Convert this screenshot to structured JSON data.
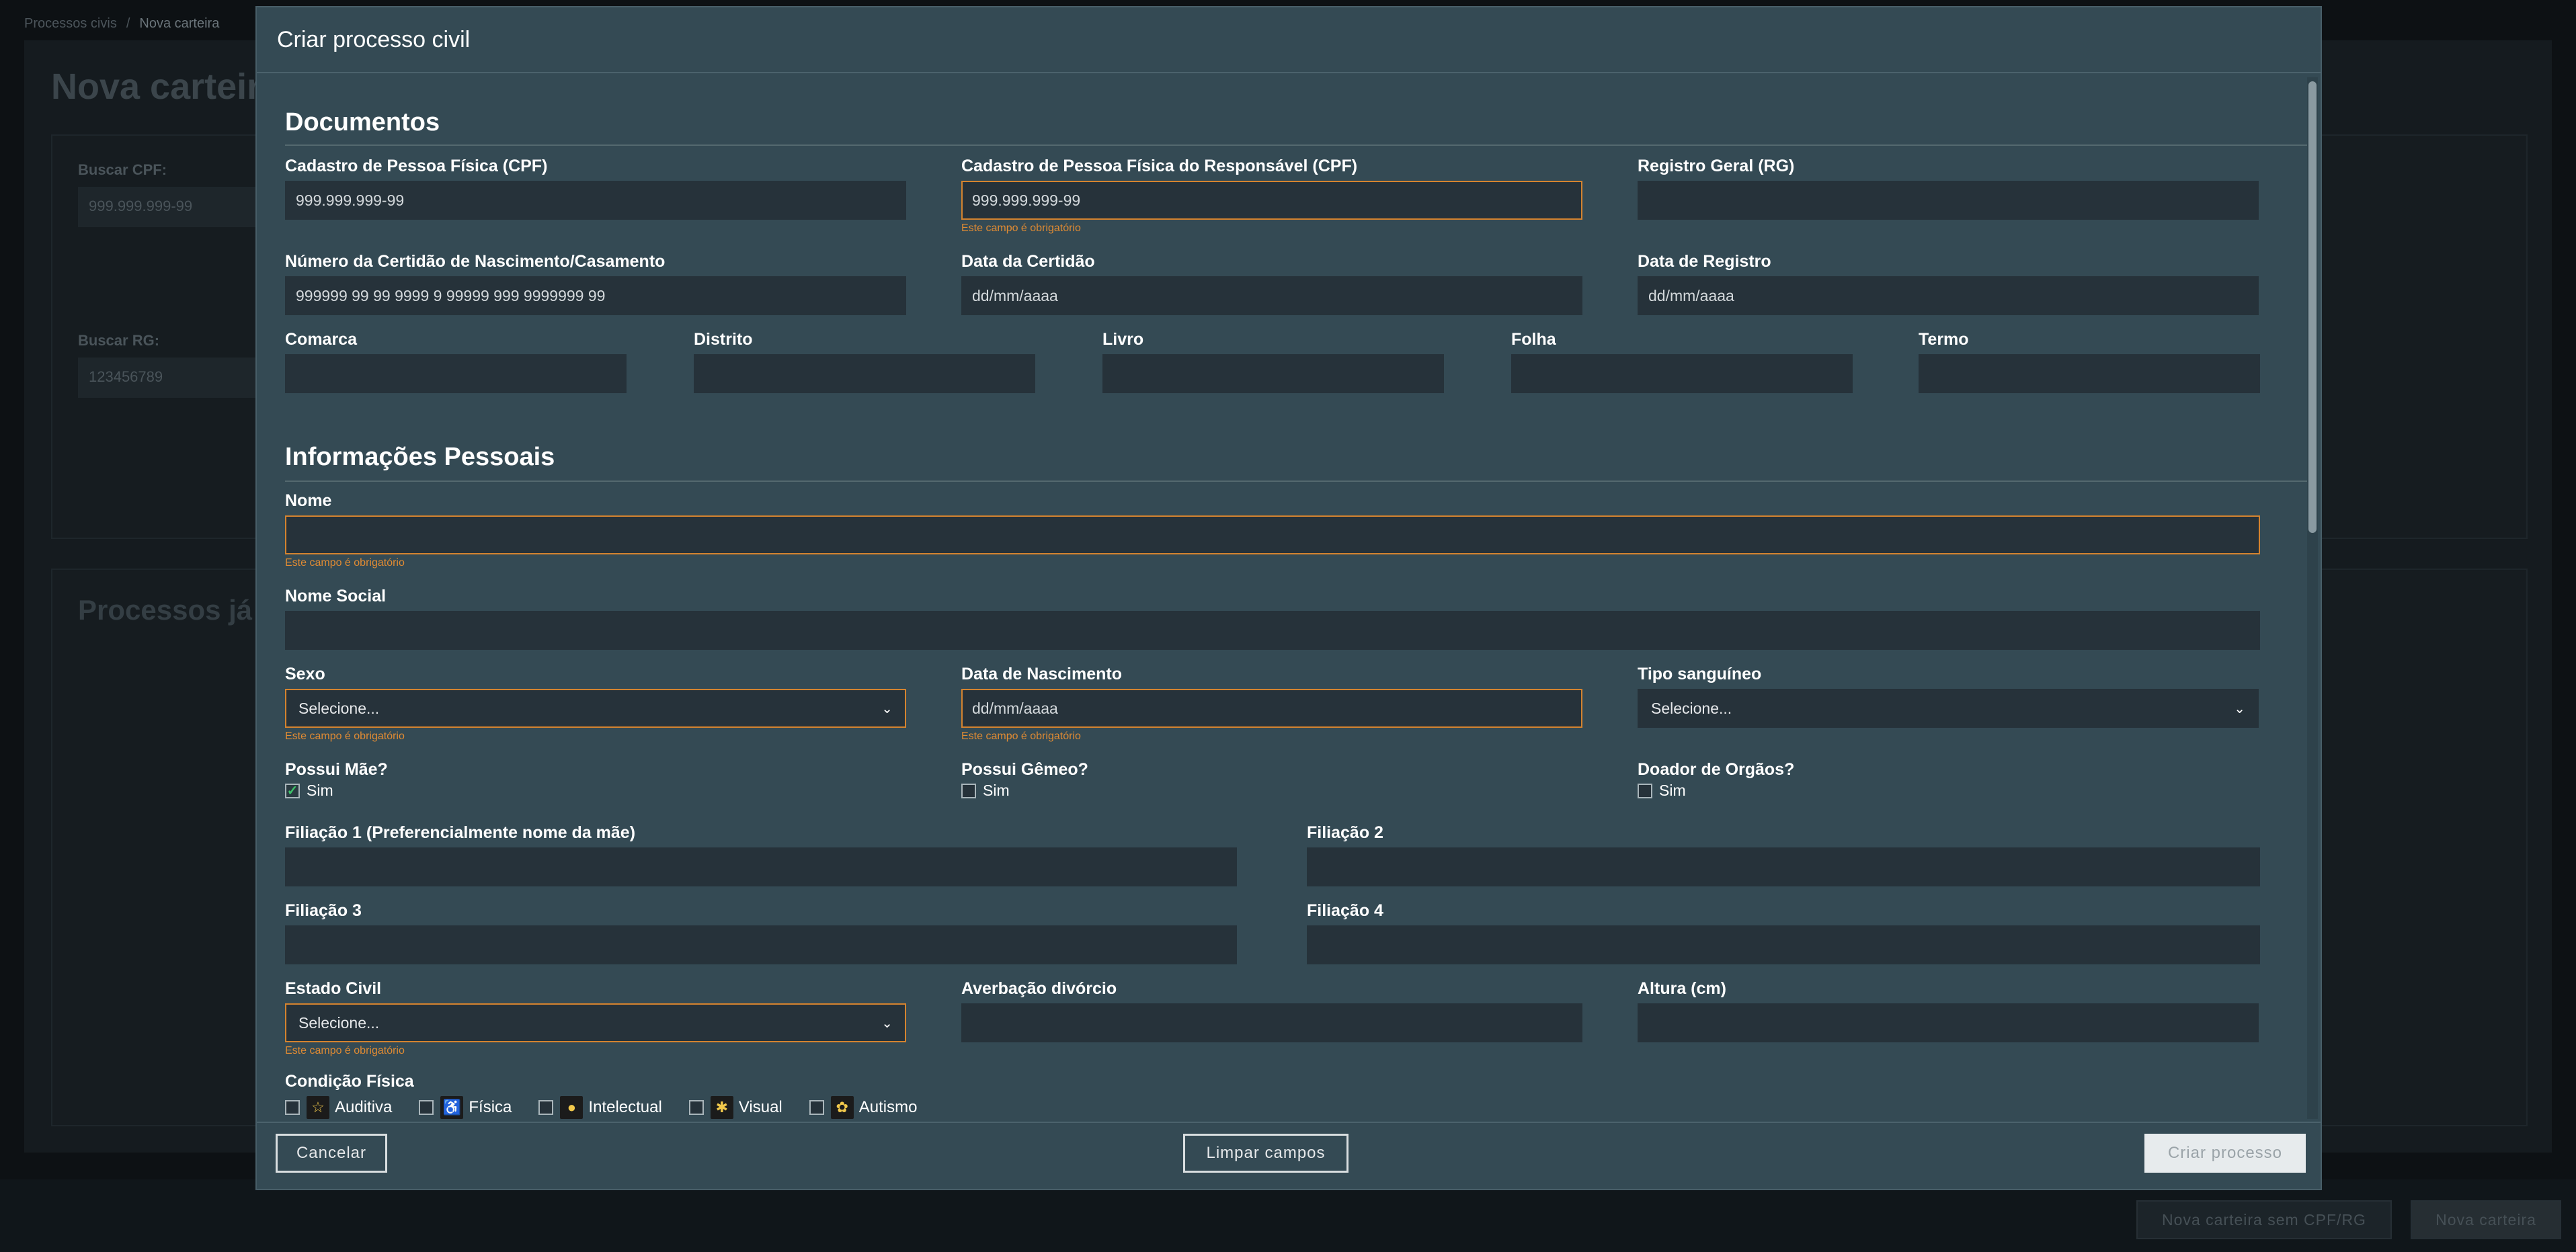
{
  "background": {
    "breadcrumb": {
      "root": "Processos civis",
      "separator": "/",
      "current": "Nova carteira"
    },
    "page_title": "Nova carteira",
    "search_cpf_label": "Buscar CPF:",
    "search_cpf_placeholder": "999.999.999-99",
    "search_rg_label": "Buscar RG:",
    "search_rg_placeholder": "123456789",
    "existing_title": "Processos já e",
    "btn_no_doc": "Nova carteira sem CPF/RG",
    "btn_new": "Nova carteira"
  },
  "modal": {
    "title": "Criar processo civil",
    "required_msg": "Este campo é obrigatório",
    "documents": {
      "title": "Documentos",
      "cpf_label": "Cadastro de Pessoa Física (CPF)",
      "cpf_placeholder": "999.999.999-99",
      "resp_cpf_label": "Cadastro de Pessoa Física do Responsável (CPF)",
      "resp_cpf_placeholder": "999.999.999-99",
      "rg_label": "Registro Geral (RG)",
      "cert_num_label": "Número da Certidão de Nascimento/Casamento",
      "cert_num_placeholder": "999999 99 99 9999 9 99999 999 9999999 99",
      "cert_date_label": "Data da Certidão",
      "cert_date_placeholder": "dd/mm/aaaa",
      "reg_date_label": "Data de Registro",
      "reg_date_placeholder": "dd/mm/aaaa",
      "comarca_label": "Comarca",
      "distrito_label": "Distrito",
      "livro_label": "Livro",
      "folha_label": "Folha",
      "termo_label": "Termo"
    },
    "personal": {
      "title": "Informações Pessoais",
      "nome_label": "Nome",
      "nome_social_label": "Nome Social",
      "sexo_label": "Sexo",
      "sexo_value": "Selecione...",
      "nascimento_label": "Data de Nascimento",
      "nascimento_placeholder": "dd/mm/aaaa",
      "sangue_label": "Tipo sanguíneo",
      "sangue_value": "Selecione...",
      "mae_label": "Possui Mãe?",
      "gemeo_label": "Possui Gêmeo?",
      "doador_label": "Doador de Orgãos?",
      "sim": "Sim",
      "filiacao1_label": "Filiação 1 (Preferencialmente nome da mãe)",
      "filiacao2_label": "Filiação 2",
      "filiacao3_label": "Filiação 3",
      "filiacao4_label": "Filiação 4",
      "estado_civil_label": "Estado Civil",
      "estado_civil_value": "Selecione...",
      "averbacao_label": "Averbação divórcio",
      "altura_label": "Altura (cm)",
      "condicao_label": "Condição Física",
      "condicoes": [
        "Auditiva",
        "Física",
        "Intelectual",
        "Visual",
        "Autismo"
      ]
    },
    "footer": {
      "cancel": "Cancelar",
      "clear": "Limpar campos",
      "create": "Criar processo"
    }
  },
  "checkbox_states": {
    "mae": true,
    "gemeo": false,
    "doador": false
  }
}
